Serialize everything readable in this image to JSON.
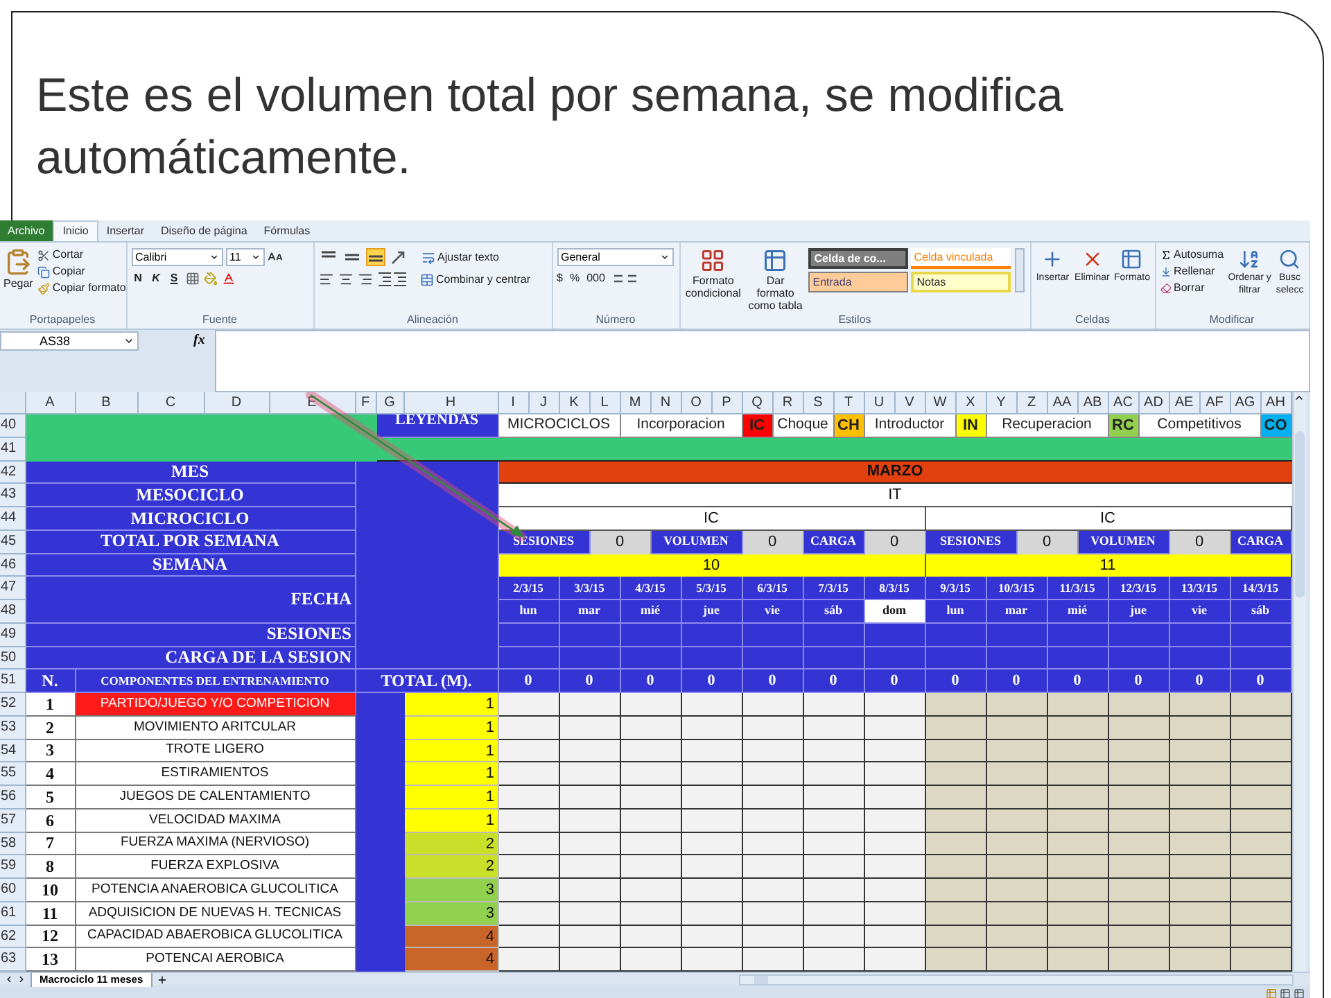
{
  "slide": {
    "title": "Este es el volumen total por semana, se modifica automáticamente."
  },
  "ribbon": {
    "tabs": [
      {
        "label": "Archivo",
        "kind": "file",
        "selected": false
      },
      {
        "label": "Inicio",
        "kind": "tab",
        "selected": true
      },
      {
        "label": "Insertar",
        "kind": "tab",
        "selected": false
      },
      {
        "label": "Diseño de página",
        "kind": "tab",
        "selected": false
      },
      {
        "label": "Fórmulas",
        "kind": "tab",
        "selected": false
      }
    ],
    "groups": [
      {
        "kind": "clipboard",
        "label": "Portapapeles",
        "paste": "Pegar",
        "items": [
          "Cortar",
          "Copiar",
          "Copiar formato"
        ]
      },
      {
        "kind": "font",
        "label": "Fuente",
        "font": "Calibri",
        "size": "11",
        "styles": [
          "N",
          "K",
          "S"
        ]
      },
      {
        "kind": "alignment",
        "label": "Alineación",
        "vertical": [
          {
            "selected": false
          },
          {
            "selected": false
          },
          {
            "selected": true
          }
        ],
        "wrap": "Ajustar texto",
        "merge": "Combinar y centrar"
      },
      {
        "kind": "number",
        "label": "Número",
        "format": "General",
        "symbols": [
          "$",
          "%",
          "000"
        ]
      },
      {
        "kind": "styles",
        "label": "Estilos",
        "buttons": [
          "Formato condicional",
          "Dar formato como tabla"
        ],
        "cells": [
          {
            "label": "Celda de co...",
            "kind": "check"
          },
          {
            "label": "Celda vinculada",
            "kind": "linked"
          },
          {
            "label": "Entrada",
            "kind": "input"
          },
          {
            "label": "Notas",
            "kind": "note"
          }
        ]
      },
      {
        "kind": "cells",
        "label": "Celdas",
        "buttons": [
          "Insertar",
          "Eliminar",
          "Formato"
        ]
      },
      {
        "kind": "editing",
        "label": "Modificar",
        "items": [
          "Autosuma",
          "Rellenar",
          "Borrar"
        ],
        "buttons": [
          "Ordenar y filtrar",
          "Busc selecc"
        ]
      }
    ]
  },
  "formula_bar": {
    "name_box": "AS38",
    "function_symbol": "fx"
  },
  "sheet": {
    "columns": [
      "A",
      "B",
      "C",
      "D",
      "E",
      "F",
      "G",
      "H",
      "I",
      "J",
      "K",
      "L",
      "M",
      "N",
      "O",
      "P",
      "Q",
      "R",
      "S",
      "T",
      "U",
      "V",
      "W",
      "X",
      "Y",
      "Z",
      "AA",
      "AB",
      "AC",
      "AD",
      "AE",
      "AF",
      "AG",
      "AH"
    ],
    "row_numbers": [
      "40",
      "41",
      "42",
      "43",
      "44",
      "45",
      "46",
      "47",
      "48",
      "49",
      "50",
      "51",
      "52",
      "53",
      "54",
      "55",
      "56",
      "57",
      "58",
      "59",
      "60",
      "61",
      "62",
      "63"
    ],
    "legend": {
      "title": "LEYENDAS",
      "items": [
        {
          "kind": "text",
          "label": "MICROCICLOS"
        },
        {
          "kind": "text",
          "label": "Incorporacion"
        },
        {
          "kind": "code",
          "label": "IC",
          "color": "#ff0000"
        },
        {
          "kind": "text",
          "label": "Choque"
        },
        {
          "kind": "code",
          "label": "CH",
          "color": "#ffc000"
        },
        {
          "kind": "text",
          "label": "Introductor"
        },
        {
          "kind": "code",
          "label": "IN",
          "color": "#ffff00"
        },
        {
          "kind": "text",
          "label": "Recuperacion"
        },
        {
          "kind": "code",
          "label": "RC",
          "color": "#92d050"
        },
        {
          "kind": "text",
          "label": "Competitivos"
        },
        {
          "kind": "code",
          "label": "CO",
          "color": "#00b0f0"
        }
      ]
    },
    "row_labels": [
      "MES",
      "MESOCICLO",
      "MICROCICLO",
      "TOTAL POR SEMANA",
      "SEMANA",
      "FECHA",
      "SESIONES",
      "CARGA DE LA SESION"
    ],
    "month": "MARZO",
    "mesocycle": "IT",
    "weeks": [
      {
        "microcycle": "IC",
        "week": "10",
        "totals": [
          {
            "label": "SESIONES",
            "value": "0"
          },
          {
            "label": "VOLUMEN",
            "value": "0"
          },
          {
            "label": "CARGA",
            "value": "0"
          }
        ],
        "days": [
          {
            "date": "2/3/15",
            "weekday": "lun",
            "total": "0",
            "highlighted": false
          },
          {
            "date": "3/3/15",
            "weekday": "mar",
            "total": "0",
            "highlighted": false
          },
          {
            "date": "4/3/15",
            "weekday": "mié",
            "total": "0",
            "highlighted": false
          },
          {
            "date": "5/3/15",
            "weekday": "jue",
            "total": "0",
            "highlighted": false
          },
          {
            "date": "6/3/15",
            "weekday": "vie",
            "total": "0",
            "highlighted": false
          },
          {
            "date": "7/3/15",
            "weekday": "sáb",
            "total": "0",
            "highlighted": false
          },
          {
            "date": "8/3/15",
            "weekday": "dom",
            "total": "0",
            "highlighted": true
          }
        ]
      },
      {
        "microcycle": "IC",
        "week": "11",
        "totals": [
          {
            "label": "SESIONES",
            "value": "0"
          },
          {
            "label": "VOLUMEN",
            "value": "0"
          },
          {
            "label": "CARGA"
          }
        ],
        "days": [
          {
            "date": "9/3/15",
            "weekday": "lun",
            "total": "0",
            "highlighted": false
          },
          {
            "date": "10/3/15",
            "weekday": "mar",
            "total": "0",
            "highlighted": false
          },
          {
            "date": "11/3/15",
            "weekday": "mié",
            "total": "0",
            "highlighted": false
          },
          {
            "date": "12/3/15",
            "weekday": "jue",
            "total": "0",
            "highlighted": false
          },
          {
            "date": "13/3/15",
            "weekday": "vie",
            "total": "0",
            "highlighted": false
          },
          {
            "date": "14/3/15",
            "weekday": "sáb",
            "total": "0",
            "highlighted": false
          }
        ]
      }
    ],
    "table_header": {
      "number": "N.",
      "component": "COMPONENTES DEL ENTRENAMIENTO",
      "total": "TOTAL (M)."
    },
    "components": [
      {
        "number": "1",
        "name": "PARTIDO/JUEGO Y/O COMPETICION",
        "value": "1",
        "color": "#ffff00",
        "highlighted": true
      },
      {
        "number": "2",
        "name": "MOVIMIENTO ARITCULAR",
        "value": "1",
        "color": "#ffff00",
        "highlighted": false
      },
      {
        "number": "3",
        "name": "TROTE LIGERO",
        "value": "1",
        "color": "#ffff00",
        "highlighted": false
      },
      {
        "number": "4",
        "name": "ESTIRAMIENTOS",
        "value": "1",
        "color": "#ffff00",
        "highlighted": false
      },
      {
        "number": "5",
        "name": "JUEGOS DE CALENTAMIENTO",
        "value": "1",
        "color": "#ffff00",
        "highlighted": false
      },
      {
        "number": "6",
        "name": "VELOCIDAD MAXIMA",
        "value": "1",
        "color": "#ffff00",
        "highlighted": false
      },
      {
        "number": "7",
        "name": "FUERZA MAXIMA (NERVIOSO)",
        "value": "2",
        "color": "#c8e02a",
        "highlighted": false
      },
      {
        "number": "8",
        "name": "FUERZA EXPLOSIVA",
        "value": "2",
        "color": "#c8e02a",
        "highlighted": false
      },
      {
        "number": "10",
        "name": "POTENCIA ANAEROBICA GLUCOLITICA",
        "value": "3",
        "color": "#92d050",
        "highlighted": false
      },
      {
        "number": "11",
        "name": "ADQUISICION DE NUEVAS H. TECNICAS",
        "value": "3",
        "color": "#92d050",
        "highlighted": false
      },
      {
        "number": "12",
        "name": "CAPACIDAD ABAEROBICA GLUCOLITICA",
        "value": "4",
        "color": "#c8662a",
        "highlighted": false
      },
      {
        "number": "13",
        "name": "POTENCAI AEROBICA",
        "value": "4",
        "color": "#c8662a",
        "highlighted": false
      }
    ],
    "sheet_tabs": [
      {
        "label": "Macrociclo 11 meses",
        "selected": true
      }
    ]
  }
}
